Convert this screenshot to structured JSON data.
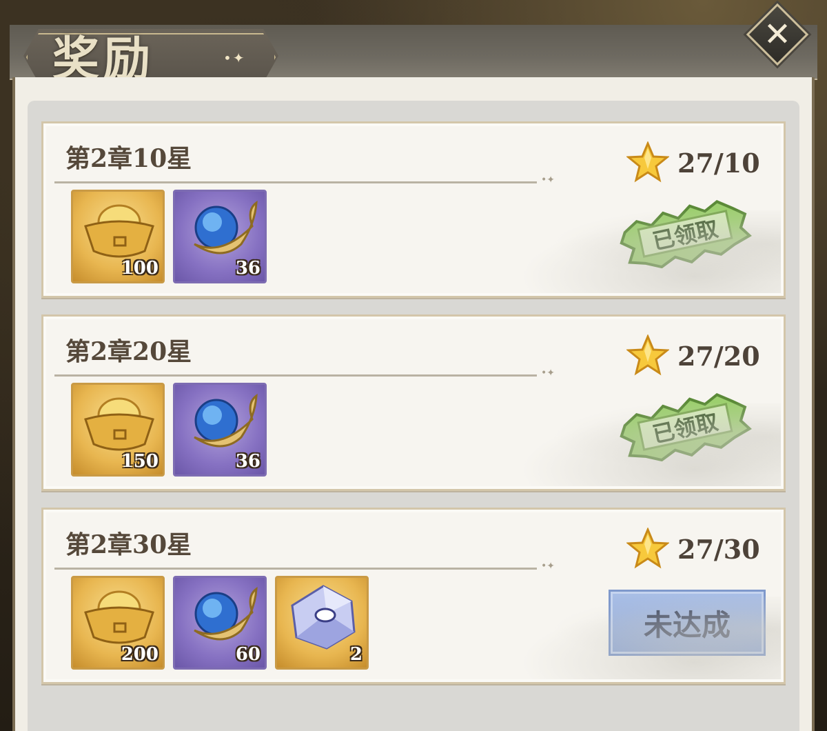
{
  "window": {
    "title": "奖励",
    "close_icon": "close-icon"
  },
  "rewards": [
    {
      "title": "第2章10星",
      "progress": "27/10",
      "status": "已领取",
      "status_type": "claimed",
      "items": [
        {
          "icon": "gold-ingot-icon",
          "count": "100"
        },
        {
          "icon": "blue-orb-icon",
          "count": "36"
        }
      ]
    },
    {
      "title": "第2章20星",
      "progress": "27/20",
      "status": "已领取",
      "status_type": "claimed",
      "items": [
        {
          "icon": "gold-ingot-icon",
          "count": "150"
        },
        {
          "icon": "blue-orb-icon",
          "count": "36"
        }
      ]
    },
    {
      "title": "第2章30星",
      "progress": "27/30",
      "status": "未达成",
      "status_type": "not-achieved",
      "items": [
        {
          "icon": "gold-ingot-icon",
          "count": "200"
        },
        {
          "icon": "blue-orb-icon",
          "count": "60"
        },
        {
          "icon": "crystal-icon",
          "count": "2"
        }
      ]
    }
  ],
  "colors": {
    "claimed_stamp": "#9ccf6e",
    "not_achieved_button": "#97b0de",
    "gold_frame": "#e8b650",
    "purple_frame": "#8671c2"
  }
}
